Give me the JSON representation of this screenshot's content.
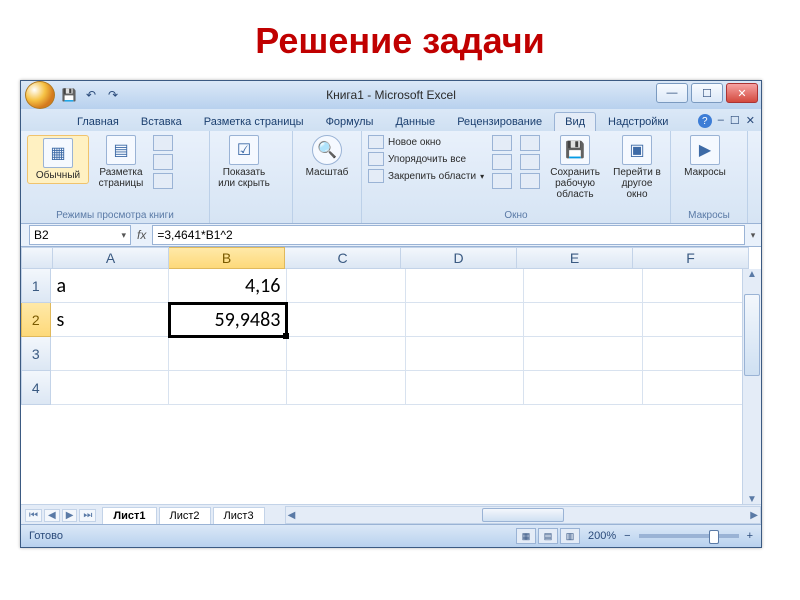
{
  "slide": {
    "title": "Решение задачи"
  },
  "window": {
    "title": "Книга1 - Microsoft Excel"
  },
  "qat": {
    "save": "💾",
    "undo": "↶",
    "redo": "↷"
  },
  "tabs": {
    "items": [
      "Главная",
      "Вставка",
      "Разметка страницы",
      "Формулы",
      "Данные",
      "Рецензирование",
      "Вид",
      "Надстройки"
    ],
    "active": "Вид"
  },
  "ribbon": {
    "group_views": {
      "label": "Режимы просмотра книги",
      "normal": "Обычный",
      "page_layout": "Разметка\nстраницы"
    },
    "group_show": {
      "show_hide": "Показать\nили скрыть"
    },
    "group_zoom": {
      "zoom": "Масштаб"
    },
    "group_window": {
      "label": "Окно",
      "new_window": "Новое окно",
      "arrange_all": "Упорядочить все",
      "freeze": "Закрепить области",
      "save_workspace": "Сохранить\nрабочую область",
      "switch_window": "Перейти в\nдругое окно"
    },
    "group_macros": {
      "label": "Макросы",
      "macros": "Макросы"
    }
  },
  "formula_bar": {
    "name_box": "B2",
    "fx": "fx",
    "formula": "=3,4641*B1^2"
  },
  "grid": {
    "columns": [
      "A",
      "B",
      "C",
      "D",
      "E",
      "F"
    ],
    "active_col": "B",
    "active_row": "2",
    "rows": [
      {
        "num": "1",
        "cells": [
          "a",
          "4,16",
          "",
          "",
          "",
          ""
        ]
      },
      {
        "num": "2",
        "cells": [
          "s",
          "59,9483",
          "",
          "",
          "",
          ""
        ]
      },
      {
        "num": "3",
        "cells": [
          "",
          "",
          "",
          "",
          "",
          ""
        ]
      },
      {
        "num": "4",
        "cells": [
          "",
          "",
          "",
          "",
          "",
          ""
        ]
      }
    ]
  },
  "sheet_tabs": [
    "Лист1",
    "Лист2",
    "Лист3"
  ],
  "status": {
    "ready": "Готово",
    "zoom": "200%"
  }
}
